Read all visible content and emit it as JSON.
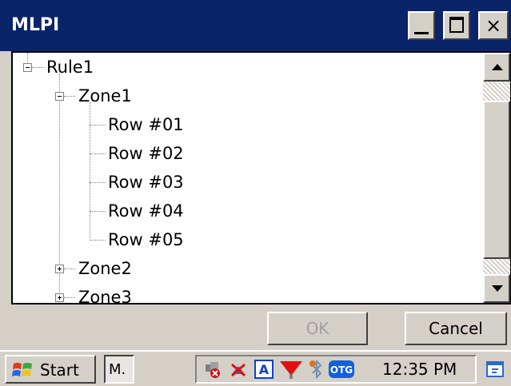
{
  "window": {
    "title": "MLPI",
    "minimize_label": "_",
    "close_label": "×"
  },
  "tree": {
    "items": [
      {
        "label": "Rule1",
        "level": 0,
        "expander": "minus"
      },
      {
        "label": "Zone1",
        "level": 1,
        "expander": "minus"
      },
      {
        "label": "Row #01",
        "level": 2
      },
      {
        "label": "Row #02",
        "level": 2
      },
      {
        "label": "Row #03",
        "level": 2
      },
      {
        "label": "Row #04",
        "level": 2
      },
      {
        "label": "Row #05",
        "level": 2
      },
      {
        "label": "Zone2",
        "level": 1,
        "expander": "plus"
      },
      {
        "label": "Zone3",
        "level": 1,
        "expander": "plus"
      }
    ]
  },
  "buttons": {
    "ok": "OK",
    "cancel": "Cancel"
  },
  "taskbar": {
    "start": "Start",
    "task_item": "M.",
    "clock": "12:35 PM",
    "tray_icons": [
      "network-disconnected-icon",
      "sync-error-icon",
      "input-mode-a-icon",
      "signal-icon",
      "bluetooth-icon",
      "otg-icon"
    ],
    "tray_a_label": "A",
    "tray_otg_label": "OTG"
  },
  "colors": {
    "titlebar": "#0a246a",
    "face": "#d4d0c8",
    "otg": "#1060e0"
  }
}
